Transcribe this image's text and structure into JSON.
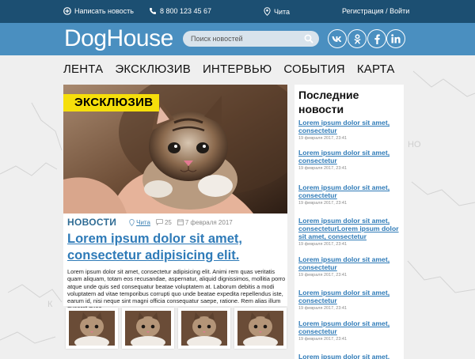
{
  "topbar": {
    "add_news": "Написать новость",
    "phone": "8 800 123 45 67",
    "city": "Чита",
    "auth": "Регистрация / Войти"
  },
  "header": {
    "logo": "DogHouse",
    "search_placeholder": "Поиск новостей",
    "social": [
      "vk-icon",
      "odnoklassniki-icon",
      "facebook-icon",
      "linkedin-icon"
    ]
  },
  "nav": [
    "ЛЕНТА",
    "ЭКСКЛЮЗИВ",
    "ИНТЕРВЬЮ",
    "СОБЫТИЯ",
    "КАРТА"
  ],
  "article": {
    "badge": "ЭКСКЛЮЗИВ",
    "category": "НОВОСТИ",
    "city": "Чита",
    "comments": "25",
    "date": "7 февраля 2017",
    "headline": "Lorem ipsum dolor sit amet, consectetur adipisicing elit.",
    "excerpt": "Lorem ipsum dolor sit amet, consectetur adipisicing elit. Animi rem quas veritatis quam aliquam, totam eos recusandae, aspernatur, aliquid dignissimos, mollitia porro atque unde quis sed consequatur beatae voluptatem at. Laborum debitis a modi voluptatem ad vitae temporibus corrupti quo unde beatae expedita repellendus iste, earum id, nisi neque sint magni officia consequatur saepe, ratione. Rem alias illum quaerat quae."
  },
  "sidebar": {
    "title": "Последние новости",
    "news": [
      {
        "title": "Lorem ipsum dolor sit amet, consectetur",
        "date": "19 февраля 2017, 23:41"
      },
      {
        "title": "Lorem ipsum dolor sit amet, consectetur",
        "date": "19 февраля 2017, 23:41"
      },
      {
        "title": "Lorem ipsum dolor sit amet, consectetur",
        "date": "19 февраля 2017, 23:41"
      },
      {
        "title": "Lorem ipsum dolor sit amet, consecteturLorem ipsum dolor sit amet, consectetur",
        "date": "19 февраля 2017, 23:41"
      },
      {
        "title": "Lorem ipsum dolor sit amet, consectetur",
        "date": "19 февраля 2017, 23:41"
      },
      {
        "title": "Lorem ipsum dolor sit amet, consectetur",
        "date": "19 февраля 2017, 23:41"
      },
      {
        "title": "Lorem ipsum dolor sit amet, consectetur",
        "date": "19 февраля 2017, 23:41"
      },
      {
        "title": "Lorem ipsum dolor sit amet,",
        "date": ""
      }
    ]
  },
  "colors": {
    "topbar": "#1c4f72",
    "header": "#4a8fc0",
    "link": "#2f7bb8",
    "badge": "#f6df0b"
  }
}
